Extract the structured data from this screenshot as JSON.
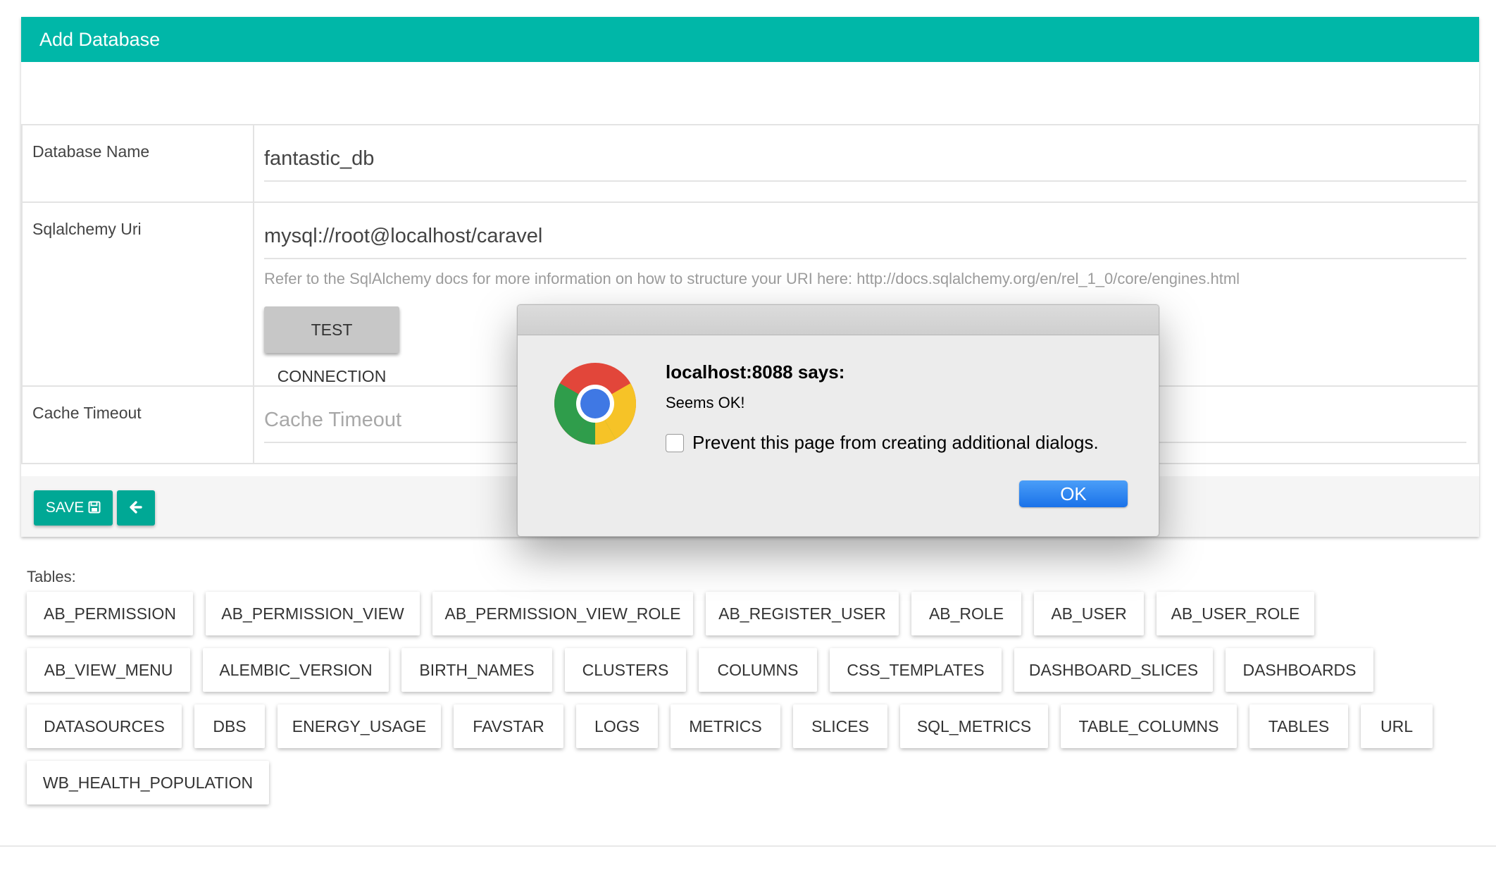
{
  "panel": {
    "title": "Add Database"
  },
  "form": {
    "database_name": {
      "label": "Database Name",
      "value": "fantastic_db"
    },
    "sqlalchemy_uri": {
      "label": "Sqlalchemy Uri",
      "value": "mysql://root@localhost/caravel",
      "help": "Refer to the SqlAlchemy docs for more information on how to structure your URI here: http://docs.sqlalchemy.org/en/rel_1_0/core/engines.html",
      "test_button": "TEST CONNECTION"
    },
    "cache_timeout": {
      "label": "Cache Timeout",
      "placeholder": "Cache Timeout",
      "value": ""
    }
  },
  "actions": {
    "save_label": "SAVE",
    "save_icon": "floppy-disk-icon",
    "back_icon": "arrow-left-icon"
  },
  "tables": {
    "label": "Tables:",
    "items": [
      "AB_PERMISSION",
      "AB_PERMISSION_VIEW",
      "AB_PERMISSION_VIEW_ROLE",
      "AB_REGISTER_USER",
      "AB_ROLE",
      "AB_USER",
      "AB_USER_ROLE",
      "AB_VIEW_MENU",
      "ALEMBIC_VERSION",
      "BIRTH_NAMES",
      "CLUSTERS",
      "COLUMNS",
      "CSS_TEMPLATES",
      "DASHBOARD_SLICES",
      "DASHBOARDS",
      "DATASOURCES",
      "DBS",
      "ENERGY_USAGE",
      "FAVSTAR",
      "LOGS",
      "METRICS",
      "SLICES",
      "SQL_METRICS",
      "TABLE_COLUMNS",
      "TABLES",
      "URL",
      "WB_HEALTH_POPULATION"
    ]
  },
  "dialog": {
    "title": "localhost:8088 says:",
    "message": "Seems OK!",
    "checkbox_label": "Prevent this page from creating additional dialogs.",
    "checkbox_checked": false,
    "ok_label": "OK",
    "icon": "chrome-logo-icon"
  },
  "colors": {
    "header": "#00b7a8",
    "button_green": "#00a895",
    "ok_blue": "#1a72e9"
  }
}
